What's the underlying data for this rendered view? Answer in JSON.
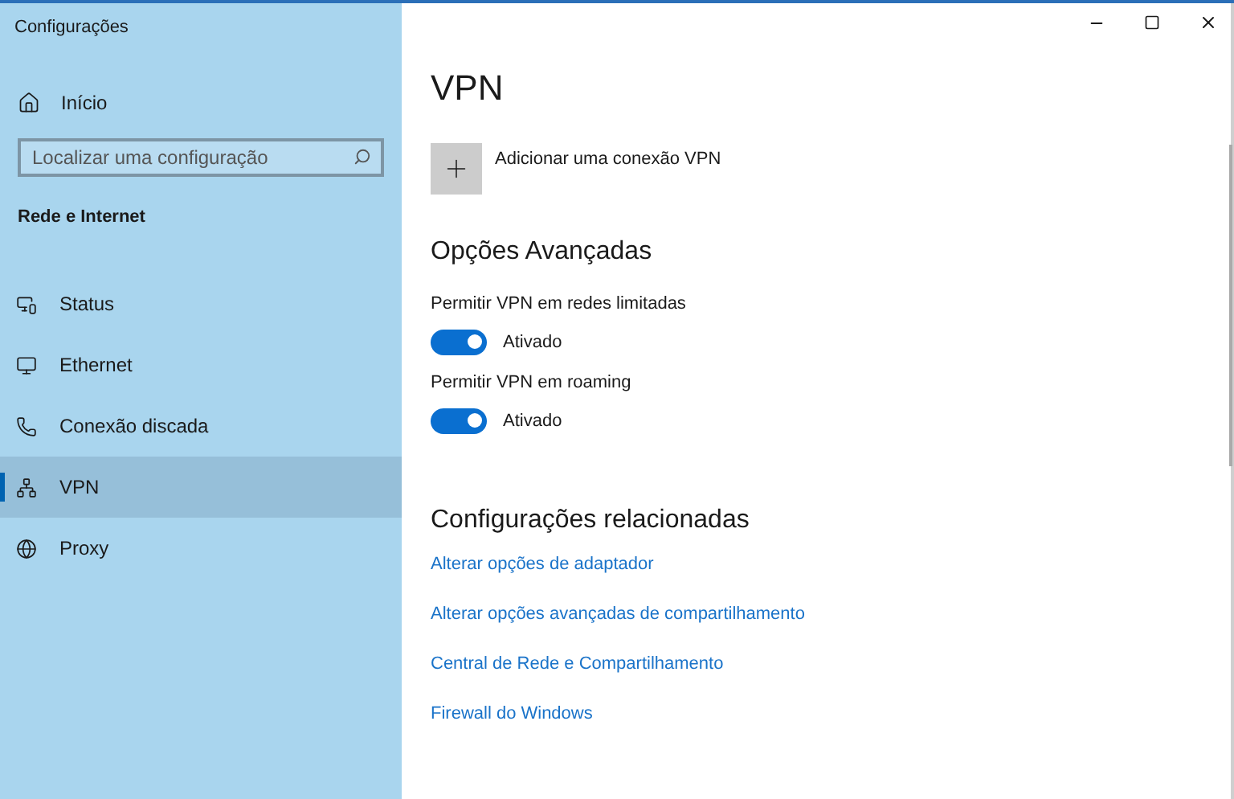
{
  "window": {
    "title": "Configurações"
  },
  "sidebar": {
    "home": "Início",
    "search": {
      "placeholder": "Localizar uma configuração"
    },
    "section": "Rede e Internet",
    "items": [
      {
        "label": "Status",
        "selected": false
      },
      {
        "label": "Ethernet",
        "selected": false
      },
      {
        "label": "Conexão discada",
        "selected": false
      },
      {
        "label": "VPN",
        "selected": true
      },
      {
        "label": "Proxy",
        "selected": false
      }
    ]
  },
  "page": {
    "title": "VPN",
    "add_button": "Adicionar uma conexão VPN",
    "advanced": {
      "heading": "Opções Avançadas",
      "toggles": [
        {
          "label": "Permitir VPN em redes limitadas",
          "on": true,
          "state": "Ativado"
        },
        {
          "label": "Permitir VPN em roaming",
          "on": true,
          "state": "Ativado"
        }
      ]
    },
    "related": {
      "heading": "Configurações relacionadas",
      "links": [
        "Alterar opções de adaptador",
        "Alterar opções avançadas de compartilhamento",
        "Central de Rede e Compartilhamento",
        "Firewall do Windows"
      ]
    }
  }
}
